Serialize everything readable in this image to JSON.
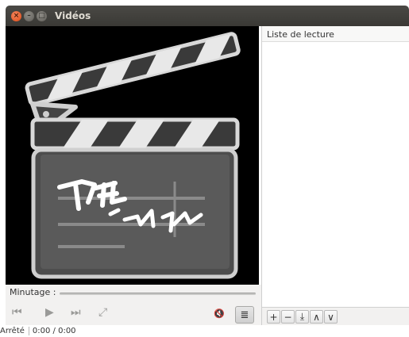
{
  "window": {
    "title": "Vidéos",
    "close_glyph": "×",
    "minimize_glyph": "–",
    "maximize_glyph": "□"
  },
  "playlist": {
    "header": "Liste de lecture",
    "tools": [
      {
        "name": "add-button",
        "glyph": "+"
      },
      {
        "name": "remove-button",
        "glyph": "−"
      },
      {
        "name": "save-playlist-button",
        "glyph": "⤓"
      },
      {
        "name": "move-up-button",
        "glyph": "∧"
      },
      {
        "name": "move-down-button",
        "glyph": "∨"
      }
    ]
  },
  "controls": {
    "timer_label": "Minutage :",
    "seek_progress": 0,
    "buttons": [
      {
        "name": "previous-button",
        "icon": "skip-back-icon",
        "glyph": "⏮"
      },
      {
        "name": "play-button",
        "icon": "play-icon",
        "glyph": "▶"
      },
      {
        "name": "next-button",
        "icon": "skip-forward-icon",
        "glyph": "⏭"
      },
      {
        "name": "fullscreen-button",
        "icon": "fullscreen-icon",
        "glyph": "⤢"
      }
    ],
    "volume_glyph": "🔇",
    "playlist_toggle_glyph": "≣"
  },
  "status": {
    "state": "Arrêté",
    "time": "0:00 / 0:00"
  },
  "colors": {
    "titlebar": "#3c3b37",
    "close_button": "#df4b16",
    "artwork_stroke": "#cfcfcf",
    "artwork_fill": "#555555"
  }
}
